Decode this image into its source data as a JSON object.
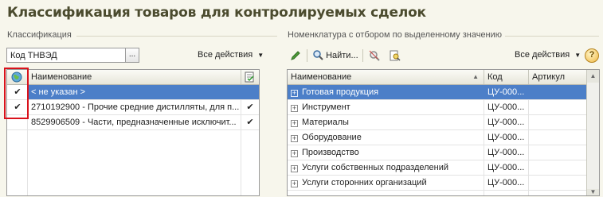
{
  "title": "Классификация товаров для контролируемых сделок",
  "left": {
    "section_label": "Классификация",
    "combo_value": "Код ТНВЭД",
    "combo_button": "...",
    "actions_label": "Все действия",
    "columns": {
      "name": "Наименование"
    },
    "rows": [
      {
        "name": "< не указан >",
        "mark": "✔",
        "check": "",
        "selected": true
      },
      {
        "name": "2710192900 - Прочие средние дистилляты, для п...",
        "mark": "✔",
        "check": "✔",
        "selected": false
      },
      {
        "name": "8529906509 - Части, предназначенные исключит...",
        "mark": "✔",
        "check": "",
        "selected": false
      }
    ]
  },
  "right": {
    "section_label": "Номенклатура с отбором по выделенному значению",
    "find_label": "Найти...",
    "actions_label": "Все действия",
    "help_label": "?",
    "columns": {
      "name": "Наименование",
      "code": "Код",
      "article": "Артикул"
    },
    "rows": [
      {
        "name": "Готовая продукция",
        "code": "ЦУ-000...",
        "article": "",
        "selected": true
      },
      {
        "name": "Инструмент",
        "code": "ЦУ-000...",
        "article": "",
        "selected": false
      },
      {
        "name": "Материалы",
        "code": "ЦУ-000...",
        "article": "",
        "selected": false
      },
      {
        "name": "Оборудование",
        "code": "ЦУ-000...",
        "article": "",
        "selected": false
      },
      {
        "name": "Производство",
        "code": "ЦУ-000...",
        "article": "",
        "selected": false
      },
      {
        "name": "Услуги собственных подразделений",
        "code": "ЦУ-000...",
        "article": "",
        "selected": false
      },
      {
        "name": "Услуги сторонних организаций",
        "code": "ЦУ-000...",
        "article": "",
        "selected": false
      }
    ]
  },
  "colors": {
    "selection": "#4c7fc8",
    "highlight_box": "#d9121b",
    "title": "#4b4b2e"
  }
}
